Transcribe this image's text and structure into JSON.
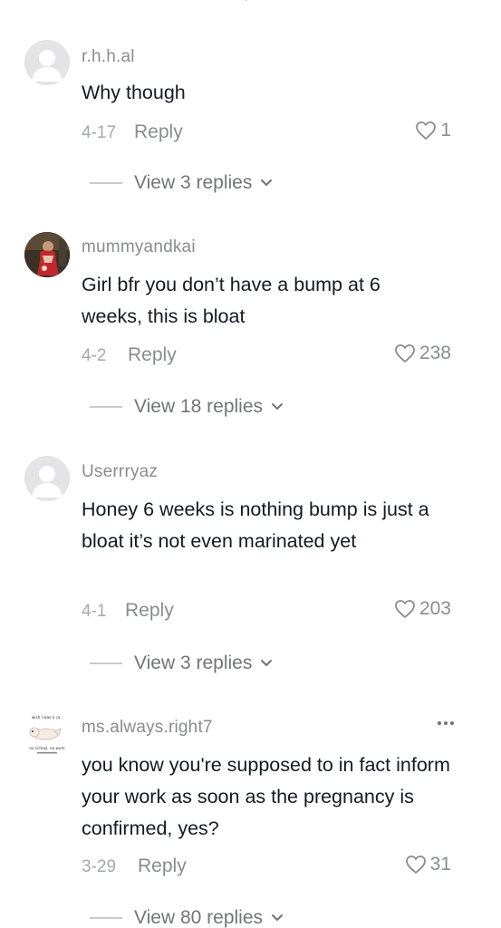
{
  "comments": [
    {
      "username": "r.h.h.al",
      "text": "Why though",
      "date": "4-17",
      "reply_label": "Reply",
      "likes": "1",
      "view_replies": "View 3 replies",
      "avatar": "default-avatar"
    },
    {
      "username": "mummyandkai",
      "text": "Girl bfr you don’t have a bump at 6 weeks, this is bloat",
      "date": "4-2",
      "reply_label": "Reply",
      "likes": "238",
      "view_replies": "View 18 replies",
      "avatar": "photo-avatar"
    },
    {
      "username": "Userrryaz",
      "text": "Honey 6 weeks is nothing bump is just a bloat it’s not even marinated yet",
      "date": "4-1",
      "reply_label": "Reply",
      "likes": "203",
      "view_replies": "View 3 replies",
      "avatar": "default-avatar"
    },
    {
      "username": "ms.always.right7",
      "text": "you know you're supposed to in fact inform your work as soon as the pregnancy is confirmed, yes?",
      "date": "3-29",
      "reply_label": "Reply",
      "likes": "31",
      "view_replies": "View 80 replies",
      "avatar": "sticker-avatar",
      "avatar_caption_top": "wish I was a ca..",
      "avatar_caption_bottom": "no school, no work"
    }
  ],
  "colors": {
    "text": "#161823",
    "muted": "#8a8b91",
    "date": "#a7a8ad",
    "divider": "#c9cace"
  }
}
